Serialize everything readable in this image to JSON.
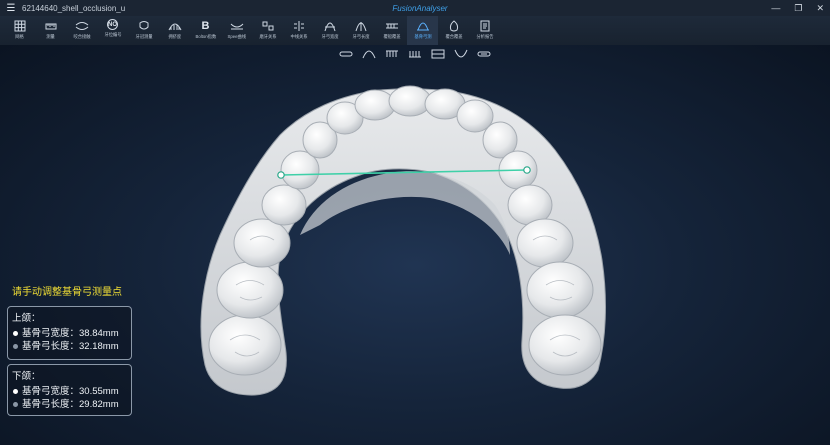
{
  "window": {
    "file_name": "62144640_shell_occlusion_u",
    "brand": "FusionAnalyser",
    "menu_glyph": "☰",
    "minimize": "—",
    "restore": "❐",
    "close": "✕"
  },
  "toolbar": {
    "tools": [
      {
        "label": "网格",
        "icon": "grid-icon"
      },
      {
        "label": "测量",
        "icon": "ruler-icon"
      },
      {
        "label": "咬合接触",
        "icon": "occlusion-icon"
      },
      {
        "label": "牙位编号",
        "icon": "tooth-number-icon",
        "glyph": "NO"
      },
      {
        "label": "牙冠测量",
        "icon": "crown-measure-icon"
      },
      {
        "label": "拥挤度",
        "icon": "crowding-icon"
      },
      {
        "label": "Bolton指数",
        "icon": "bolton-icon",
        "glyph": "B"
      },
      {
        "label": "Spee曲线",
        "icon": "spee-curve-icon"
      },
      {
        "label": "磨牙关系",
        "icon": "molar-relation-icon"
      },
      {
        "label": "中线关系",
        "icon": "midline-icon"
      },
      {
        "label": "牙弓宽度",
        "icon": "arch-width-icon"
      },
      {
        "label": "牙弓长度",
        "icon": "arch-length-icon"
      },
      {
        "label": "覆船覆盖",
        "icon": "overbite-icon"
      },
      {
        "label": "基骨弓测",
        "icon": "basal-arch-icon",
        "active": true
      },
      {
        "label": "覆合覆盖",
        "icon": "overjet-icon"
      },
      {
        "label": "分析报告",
        "icon": "report-icon"
      }
    ]
  },
  "subtoolbar": {
    "buttons": [
      "front-view-icon",
      "arch-view-icon",
      "upper-jaw-icon",
      "lower-jaw-icon",
      "both-jaws-icon",
      "occlusal-view-icon",
      "bottom-view-icon"
    ]
  },
  "viewport": {
    "instruction": "请手动调整基骨弓测量点",
    "upper": {
      "title": "上颌：",
      "width_label": "基骨弓宽度：",
      "width_value": "38.84mm",
      "length_label": "基骨弓长度：",
      "length_value": "32.18mm"
    },
    "lower": {
      "title": "下颌：",
      "width_label": "基骨弓宽度：",
      "width_value": "30.55mm",
      "length_label": "基骨弓长度：",
      "length_value": "29.82mm"
    }
  },
  "colors": {
    "accent": "#3fa0e8",
    "instruction": "#f2df35",
    "measure_line": "#3fd0a8",
    "width_dot": "#ffffff",
    "length_dot": "#8a96a6"
  }
}
